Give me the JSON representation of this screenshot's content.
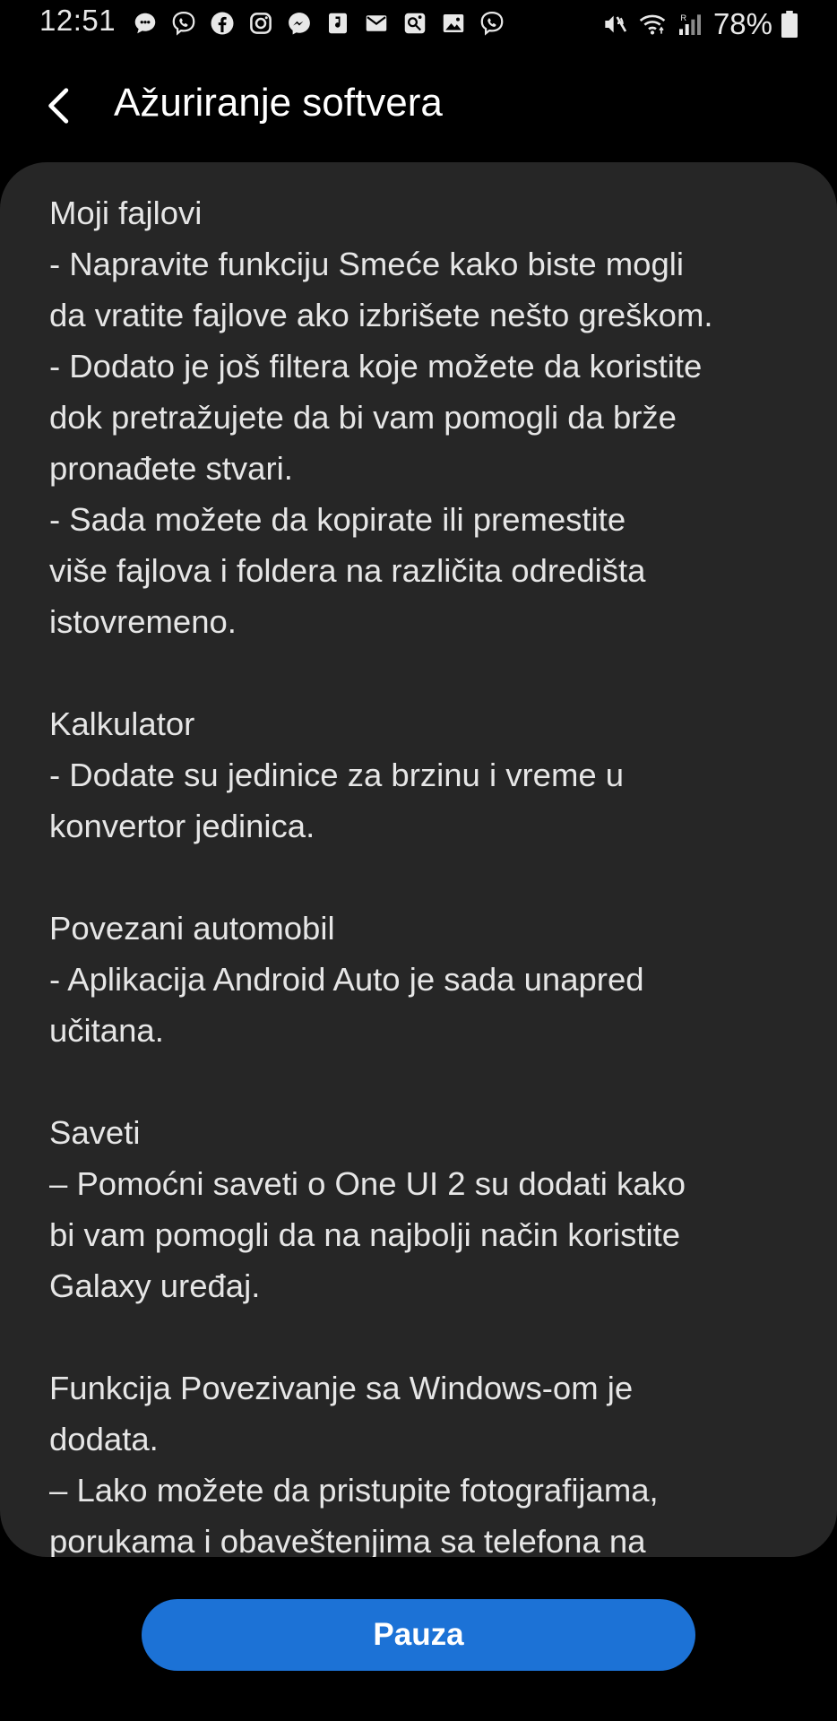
{
  "status_bar": {
    "time": "12:51",
    "battery_percent": "78%",
    "notification_icons": [
      "chat-bubble-icon",
      "viber-icon",
      "facebook-icon",
      "instagram-icon",
      "messenger-icon",
      "music-note-icon",
      "email-icon",
      "gallery-edit-icon",
      "image-icon",
      "viber-icon"
    ],
    "system_icons": [
      "mute-icon",
      "wifi-icon",
      "signal-icon",
      "battery-icon"
    ]
  },
  "header": {
    "title": "Ažuriranje softvera",
    "back_icon": "chevron-left-icon"
  },
  "content": {
    "sections": [
      {
        "title": "Moji fajlovi",
        "lines": [
          "- Napravite funkciju Smeće kako biste mogli",
          "da vratite fajlove ako izbrišete nešto greškom.",
          "- Dodato je još filtera koje možete da koristite",
          "dok pretražujete da bi vam pomogli da brže",
          "pronađete stvari.",
          "- Sada možete da kopirate ili premestite",
          "više fajlova i foldera na različita odredišta",
          "istovremeno."
        ]
      },
      {
        "title": "Kalkulator",
        "lines": [
          "- Dodate su jedinice za brzinu i vreme u",
          "konvertor jedinica."
        ]
      },
      {
        "title": "Povezani automobil",
        "lines": [
          "- Aplikacija Android Auto je sada unapred",
          "učitana."
        ]
      },
      {
        "title": "Saveti",
        "lines": [
          "– Pomoćni saveti o One UI 2 su dodati kako",
          "bi vam pomogli da na najbolji način koristite",
          "Galaxy uređaj."
        ]
      },
      {
        "title": "Funkcija Povezivanje sa Windows-om je",
        "lines": [
          "dodata.",
          "– Lako možete da pristupite fotografijama,",
          "porukama i obaveštenjima sa telefona na"
        ]
      }
    ]
  },
  "footer": {
    "pause_label": "Pauza"
  },
  "colors": {
    "background": "#000000",
    "card": "#262626",
    "accent_button": "#1c72d6",
    "text": "#e6e6e6"
  }
}
